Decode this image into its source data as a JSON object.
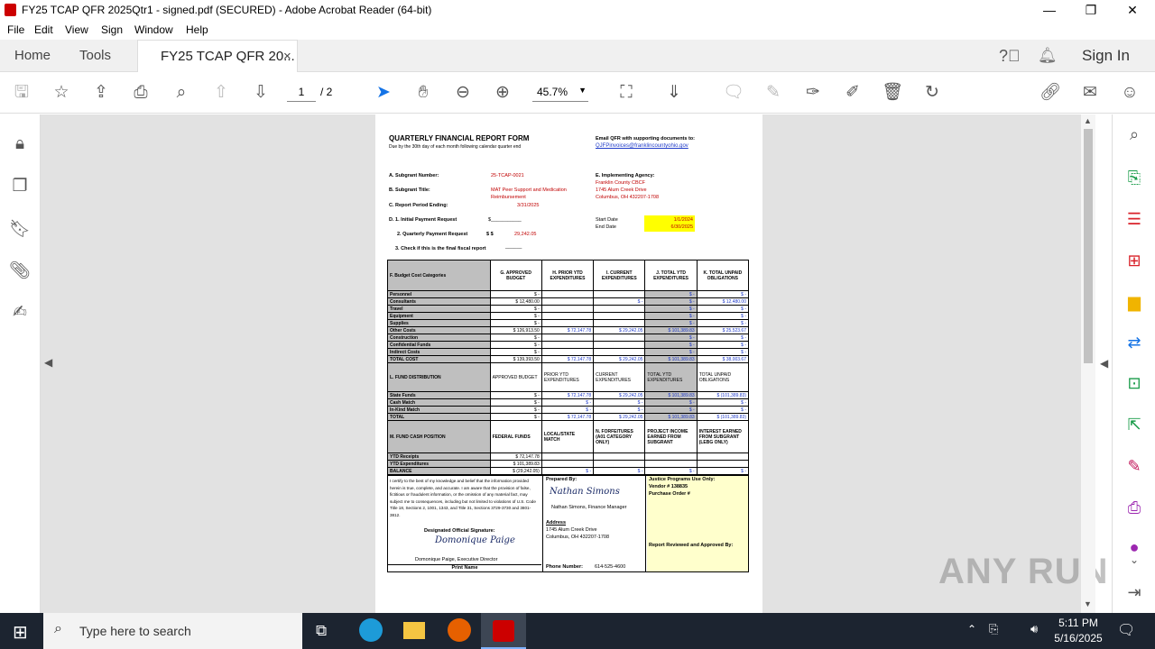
{
  "window": {
    "title": "FY25 TCAP QFR 2025Qtr1 - signed.pdf (SECURED) - Adobe Acrobat Reader (64-bit)",
    "minimize": "—",
    "maximize": "❐",
    "close": "✕"
  },
  "menu": [
    "File",
    "Edit",
    "View",
    "Sign",
    "Window",
    "Help"
  ],
  "tabs": {
    "home": "Home",
    "tools": "Tools",
    "doc": "FY25 TCAP QFR 20...",
    "doc_close": "×",
    "sign_in": "Sign In"
  },
  "toolbar": {
    "page_current": "1",
    "page_total": "/ 2",
    "zoom": "45.7%"
  },
  "doc": {
    "title": "QUARTERLY FINANCIAL REPORT FORM",
    "due": "Due by the 30th day of each month following calendar quarter end",
    "email_label": "Email QFR with supporting documents to:",
    "email": "QJFPinvoices@franklincountyohio.gov",
    "a_label": "A. Subgrant Number:",
    "a_value": "25-TCAP-0021",
    "b_label": "B. Subgrant Title:",
    "b_value1": "MAT Peer Support and Medication",
    "b_value2": "Reimbursement",
    "c_label": "C. Report Period Ending:",
    "c_value": "3/31/2025",
    "d1_label": "D. 1. Initial Payment Request",
    "d1_value": "$___________",
    "d2_label": "2. Quarterly Payment Request",
    "d2_sign": "$ $",
    "d2_value": "29,242.05",
    "d3_label": "3. Check if this is the final fiscal report",
    "d3_value": "______",
    "e_label": "E. Implementing Agency:",
    "e_line1": "Franklin County CBCF",
    "e_line2": "1745 Alum Creek Drive",
    "e_line3": "Columbus, OH 432207-1708",
    "start_label": "Start Date",
    "start_value": "1/1/2024",
    "end_label": "End Date",
    "end_value": "6/30/2025",
    "f_head": "F. Budget Cost Categories",
    "g_head": "G. APPROVED BUDGET",
    "h_head": "H. PRIOR YTD EXPENDITURES",
    "i_head": "I. CURRENT EXPENDITURES",
    "j_head": "J. TOTAL YTD EXPENDITURES",
    "k_head": "K. TOTAL UNPAID OBLIGATIONS",
    "rows": [
      {
        "label": "Personnel",
        "g": "$ -",
        "h": "",
        "i": "",
        "j": "$ -",
        "k": "$ -"
      },
      {
        "label": "Consultants",
        "g": "$ 12,480.00",
        "h": "",
        "i": "$ -",
        "j": "$ -",
        "k": "$ 12,480.00"
      },
      {
        "label": "Travel",
        "g": "$ -",
        "h": "",
        "i": "",
        "j": "$ -",
        "k": "$ -"
      },
      {
        "label": "Equipment",
        "g": "$ -",
        "h": "",
        "i": "",
        "j": "$ -",
        "k": "$ -"
      },
      {
        "label": "Supplies",
        "g": "$ -",
        "h": "",
        "i": "",
        "j": "$ -",
        "k": "$ -"
      },
      {
        "label": "Other Costs",
        "g": "$ 126,913.50",
        "h": "$ 72,147.78",
        "i": "$ 29,242.05",
        "j": "$ 101,389.83",
        "k": "$ 25,523.67"
      },
      {
        "label": "Construction",
        "g": "$ -",
        "h": "",
        "i": "",
        "j": "$ -",
        "k": "$ -"
      },
      {
        "label": "Confidential Funds",
        "g": "$ -",
        "h": "",
        "i": "",
        "j": "$ -",
        "k": "$ -"
      },
      {
        "label": "Indirect Costs",
        "g": "$ -",
        "h": "",
        "i": "",
        "j": "$ -",
        "k": "$ -"
      },
      {
        "label": "TOTAL COST",
        "g": "$ 139,393.50",
        "h": "$ 72,147.78",
        "i": "$ 29,242.05",
        "j": "$ 101,389.83",
        "k": "$ 38,003.67"
      }
    ],
    "l_head": "L. FUND DISTRIBUTION",
    "l_g": "APPROVED BUDGET",
    "l_h": "PRIOR YTD EXPENDITURES",
    "l_i": "CURRENT EXPENDITURES",
    "l_j": "TOTAL YTD EXPENDITURES",
    "l_k": "TOTAL UNPAID OBLIGATIONS",
    "lrows": [
      {
        "label": "State Funds",
        "g": "$ -",
        "h": "$ 72,147.78",
        "i": "$ 29,242.05",
        "j": "$ 101,389.83",
        "k": "$ (101,389.83)"
      },
      {
        "label": "Cash Match",
        "g": "$ -",
        "h": "$ -",
        "i": "$ -",
        "j": "$ -",
        "k": "$ -"
      },
      {
        "label": "In-Kind Match",
        "g": "$ -",
        "h": "$ -",
        "i": "$ -",
        "j": "$ -",
        "k": "$ -"
      },
      {
        "label": "TOTAL",
        "g": "$ -",
        "h": "$ 72,147.78",
        "i": "$ 29,242.05",
        "j": "$ 101,389.83",
        "k": "$ (101,389.83)"
      }
    ],
    "m_head": "M. FUND CASH POSITION",
    "m_g": "FEDERAL FUNDS",
    "m_h": "LOCAL/STATE MATCH",
    "m_i": "N. FORFEITURES (A01 CATEGORY ONLY)",
    "m_j": "PROJECT INCOME EARNED FROM SUBGRANT",
    "m_k": "INTEREST EARNED FROM SUBGRANT (LEBG ONLY)",
    "mrows": [
      {
        "label": "YTD Receipts",
        "g": "$ 72,147.78",
        "h": "",
        "i": "",
        "j": "",
        "k": ""
      },
      {
        "label": "YTD Expenditures",
        "g": "$ 101,389.83",
        "h": "",
        "i": "",
        "j": "",
        "k": ""
      },
      {
        "label": "BALANCE",
        "g": "$ (29,242.05)",
        "h": "$ -",
        "i": "$ -",
        "j": "$ -",
        "k": "$ -"
      }
    ],
    "cert": "I certify to the best of my knowledge and belief that the information provided herein is true, complete, and accurate. I am aware that the provision of false, fictitious or fraudulent information, or the omission of any material fact, may subject me to consequences, including but not limited to violations of U.S. Code Title 18, Sections 2, 1001, 1343, and Title 31, Sections 3729-3730 and 3801-3812.",
    "designated": "Designated Official Signature:",
    "sig1": "Domonique Paige",
    "sig1_name": "Domonique Paige, Executive Director",
    "print_name": "Print Name",
    "prepared": "Prepared By:",
    "sig2": "Nathan Simons",
    "sig2_name": "Nathan Simons, Finance Manager",
    "address_label": "Address",
    "address1": "1745 Alum Creek Drive",
    "address2": "Columbus, OH 432207-1708",
    "phone_label": "Phone Number:",
    "phone": "614-525-4600",
    "jp_head": "Justice Programs Use Only:",
    "vendor": "Vendor # 138835",
    "po": "Purchase Order #",
    "reviewed": "Report Reviewed and Approved By:"
  },
  "watermark": "ANY RUN",
  "taskbar": {
    "search": "Type here to search",
    "time": "5:11 PM",
    "date": "5/16/2025"
  }
}
